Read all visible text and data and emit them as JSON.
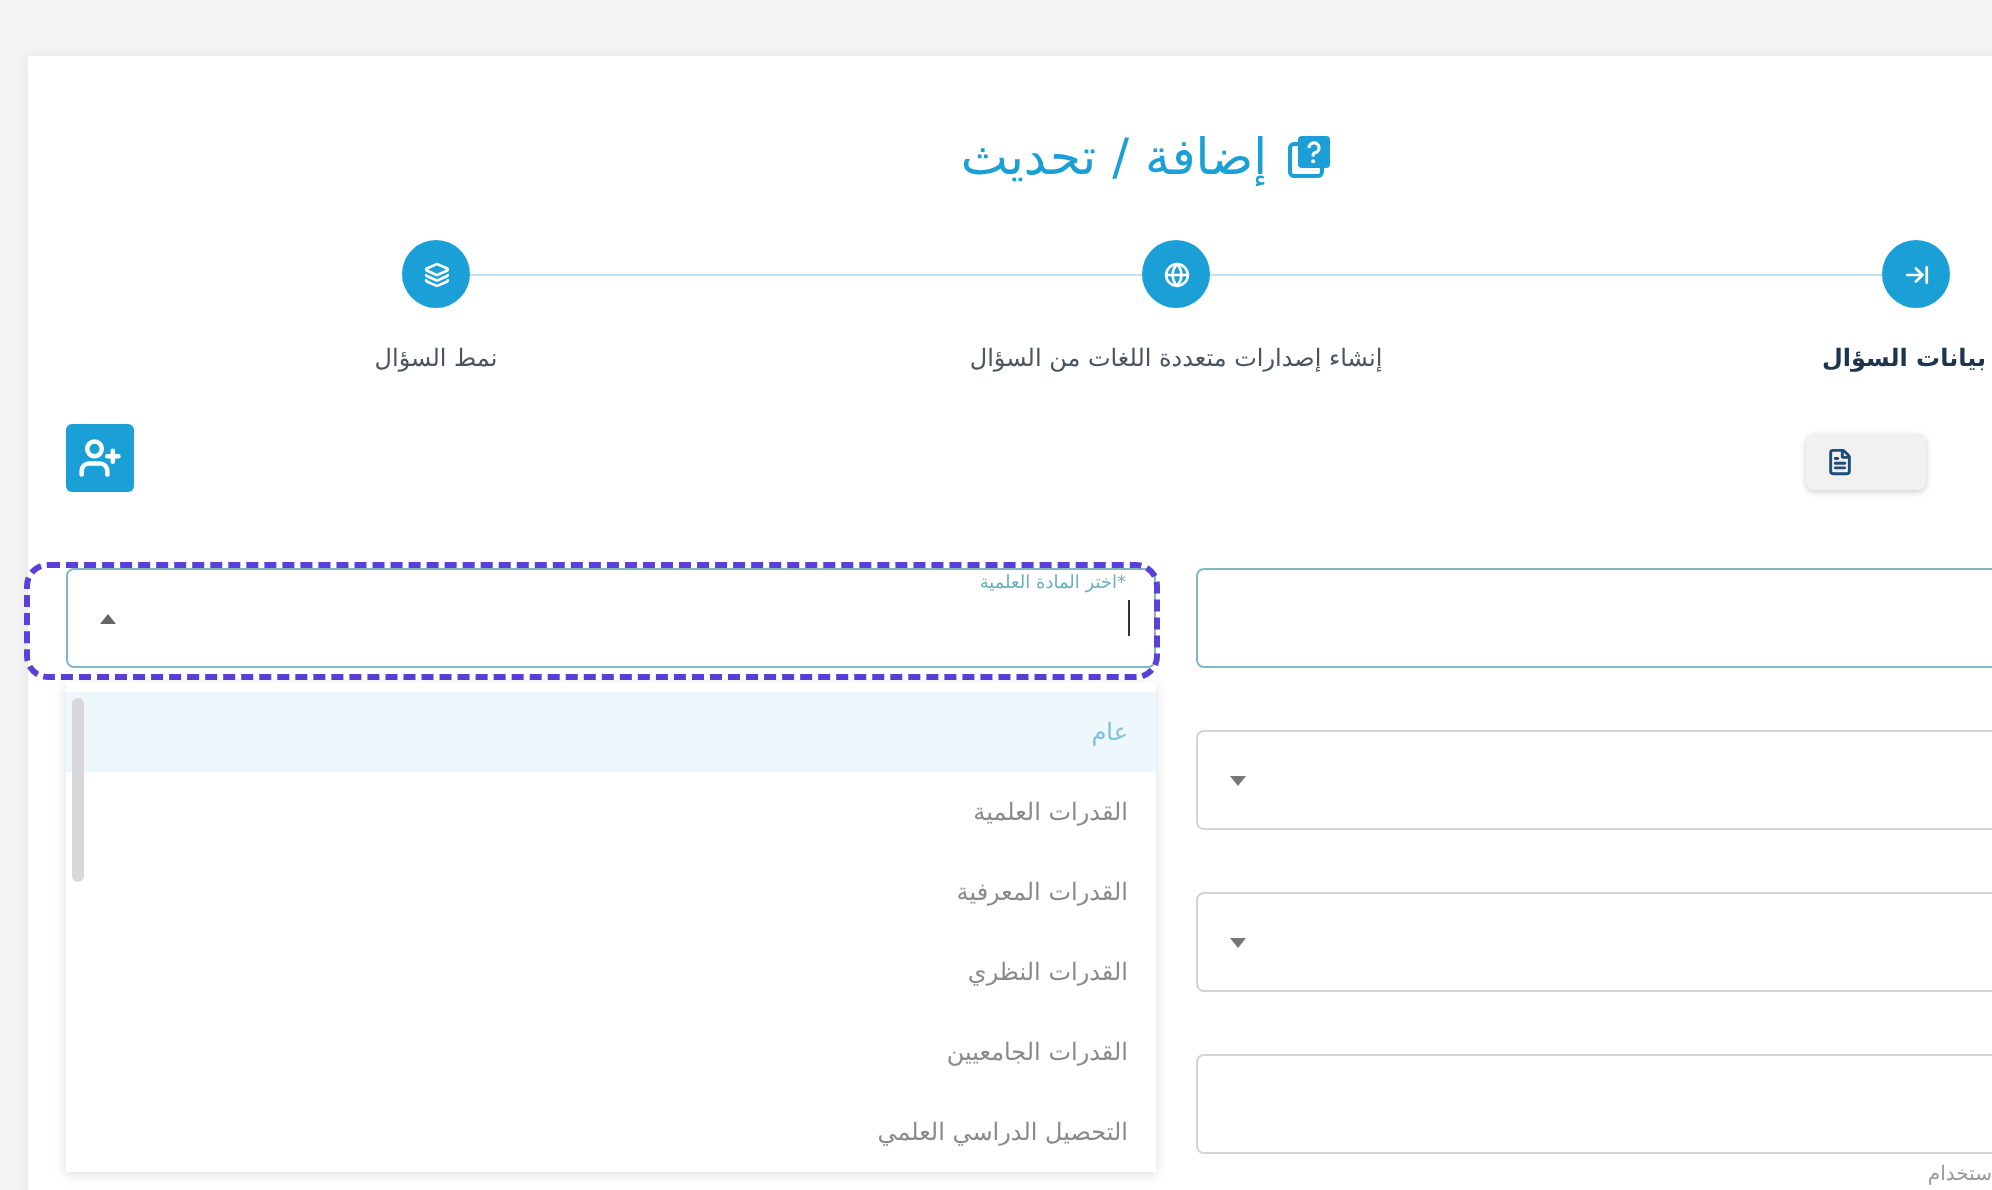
{
  "page_title": "إضافة / تحديث",
  "steps": [
    {
      "label": "بيانات السؤال",
      "selected": true
    },
    {
      "label": "إنشاء إصدارات متعددة اللغات من السؤال",
      "selected": false
    },
    {
      "label": "نمط السؤال",
      "selected": false
    }
  ],
  "subject_select": {
    "label": "اختر المادة العلمية*",
    "expanded": true,
    "options": [
      {
        "label": "عام",
        "selected": true
      },
      {
        "label": "القدرات العلمية",
        "selected": false
      },
      {
        "label": "القدرات المعرفية",
        "selected": false
      },
      {
        "label": "القدرات النظري",
        "selected": false
      },
      {
        "label": "القدرات الجامعيين",
        "selected": false
      },
      {
        "label": "التحصيل الدراسي العلمي",
        "selected": false
      }
    ]
  },
  "right_fields": [
    {
      "kind": "input",
      "focused": true
    },
    {
      "kind": "select",
      "focused": false
    },
    {
      "kind": "select",
      "focused": false
    },
    {
      "kind": "input",
      "focused": false,
      "helper": "ستخدام"
    }
  ]
}
